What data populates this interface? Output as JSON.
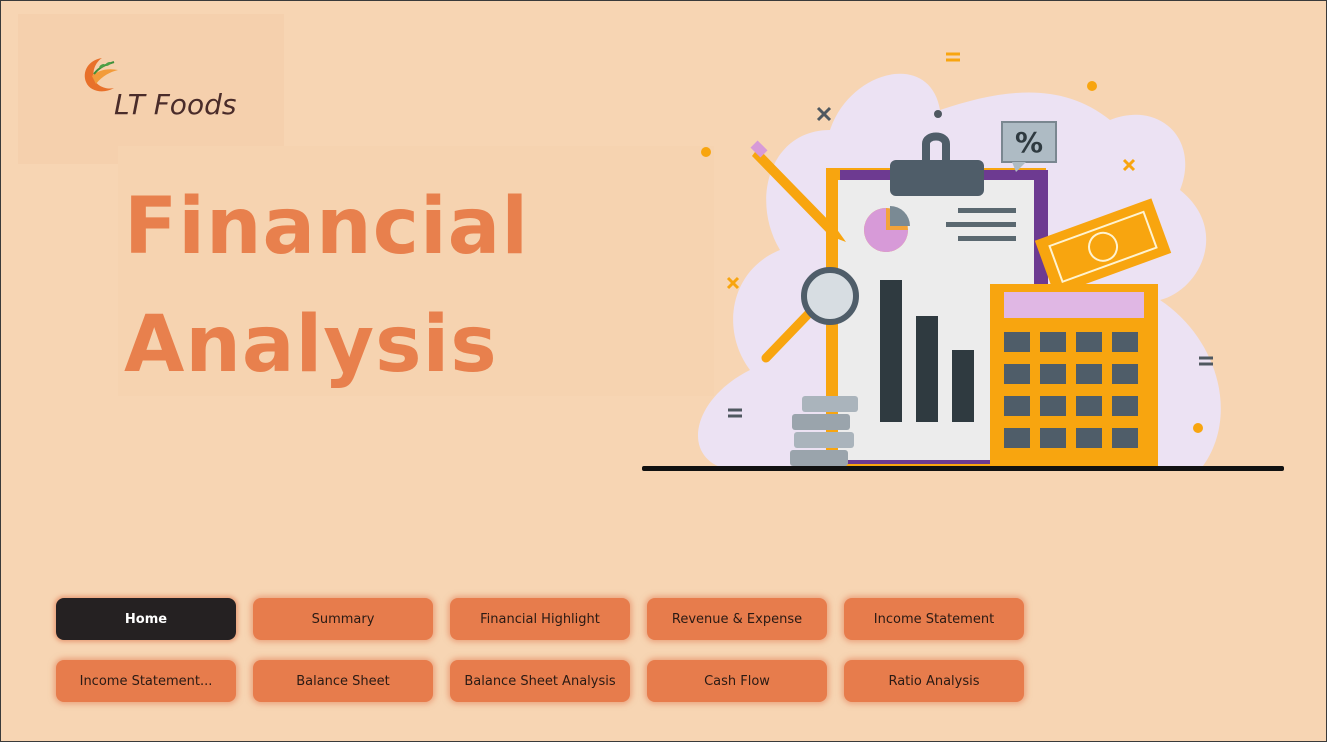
{
  "brand": {
    "name": "LT Foods",
    "logo_icon": "lt-foods-logo"
  },
  "hero": {
    "title_line1": "Financial",
    "title_line2": "Analysis"
  },
  "illustration": {
    "icon": "financial-analysis-illustration",
    "percent_symbol": "%"
  },
  "nav": {
    "items": [
      {
        "label": "Home",
        "active": true
      },
      {
        "label": "Summary"
      },
      {
        "label": "Financial Highlight"
      },
      {
        "label": "Revenue & Expense"
      },
      {
        "label": "Income Statement"
      },
      {
        "label": "Income Statement..."
      },
      {
        "label": "Balance Sheet"
      },
      {
        "label": "Balance Sheet Analysis"
      },
      {
        "label": "Cash Flow"
      },
      {
        "label": "Ratio Analysis"
      }
    ]
  },
  "colors": {
    "background": "#f7d5b3",
    "accent": "#e8804d",
    "button": "#e77c4c",
    "active_button": "#252122"
  }
}
